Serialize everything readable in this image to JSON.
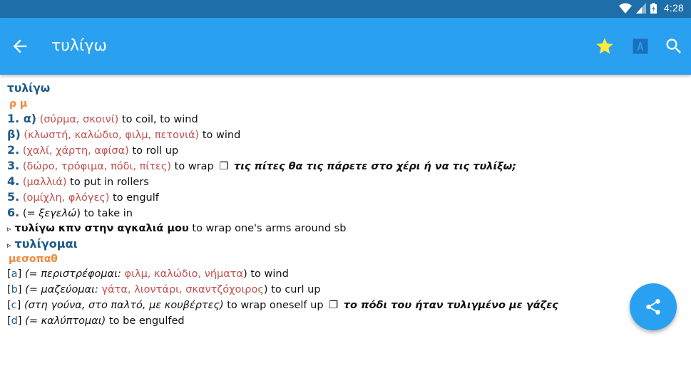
{
  "statusbar": {
    "time": "4:28",
    "icons": [
      "wifi-icon",
      "signal-icon",
      "battery-icon"
    ]
  },
  "appbar": {
    "title": "τυλίγω",
    "back_icon": "arrow-left-icon",
    "actions": [
      "star-icon",
      "font-size-icon",
      "search-icon"
    ],
    "star_color": "#ffeb3b"
  },
  "entry": {
    "headword": "τυλίγω",
    "pos": "ρ μ",
    "senses": [
      {
        "num": "1. α)",
        "ctx": "(σύρμα, σκοινί)",
        "trans": "to coil, to wind"
      },
      {
        "num": "β)",
        "ctx": "(κλωστή, καλώδιο, φιλμ, πετονιά)",
        "trans": "to wind"
      },
      {
        "num": "2.",
        "ctx": "(χαλί, χάρτη, αφίσα)",
        "trans": "to roll up"
      },
      {
        "num": "3.",
        "ctx": "(δώρο, τρόφιμα, πόδι, πίτες)",
        "trans": "to wrap",
        "box": "❐",
        "example": "τις πίτες θα τις πάρετε στο χέρι ή να τις τυλίξω;"
      },
      {
        "num": "4.",
        "ctx": "(μαλλιά)",
        "trans": "to put in rollers"
      },
      {
        "num": "5.",
        "ctx": "(ομίχλη, φλόγες)",
        "trans": "to engulf"
      },
      {
        "num": "6.",
        "it_open": "(= ",
        "it_word": "ξεγελώ",
        "it_close": ")",
        "trans": "to take in"
      }
    ],
    "phrase": {
      "tri": "▹",
      "text": "τυλίγω κπν στην αγκαλιά μου",
      "trans": "to wrap one's arms around sb"
    },
    "sub": {
      "tri": "▹",
      "headword": "τυλίγομαι",
      "pos": "μεσοπαθ"
    },
    "sub_senses": [
      {
        "label": "a",
        "syn": "(= περιστρέφομαι: ",
        "ctx": "φιλμ, καλώδιο, νήματα",
        "close": ")",
        "trans": "to wind"
      },
      {
        "label": "b",
        "syn": "(= μαζεύομαι: ",
        "ctx": "γάτα, λιοντάρι, σκαντζόχοιρος",
        "close": ")",
        "trans": "to curl up"
      },
      {
        "label": "c",
        "syn": "(στη γούνα, στο παλτό, με κουβέρτες)",
        "trans": "to wrap oneself up",
        "box": "❐",
        "example": "το πόδι του ήταν τυλιγμένο με γάζες"
      },
      {
        "label": "d",
        "syn": "(= καλύπτομαι)",
        "trans": "to be engulfed"
      }
    ]
  },
  "fab": {
    "icon": "share-icon"
  }
}
